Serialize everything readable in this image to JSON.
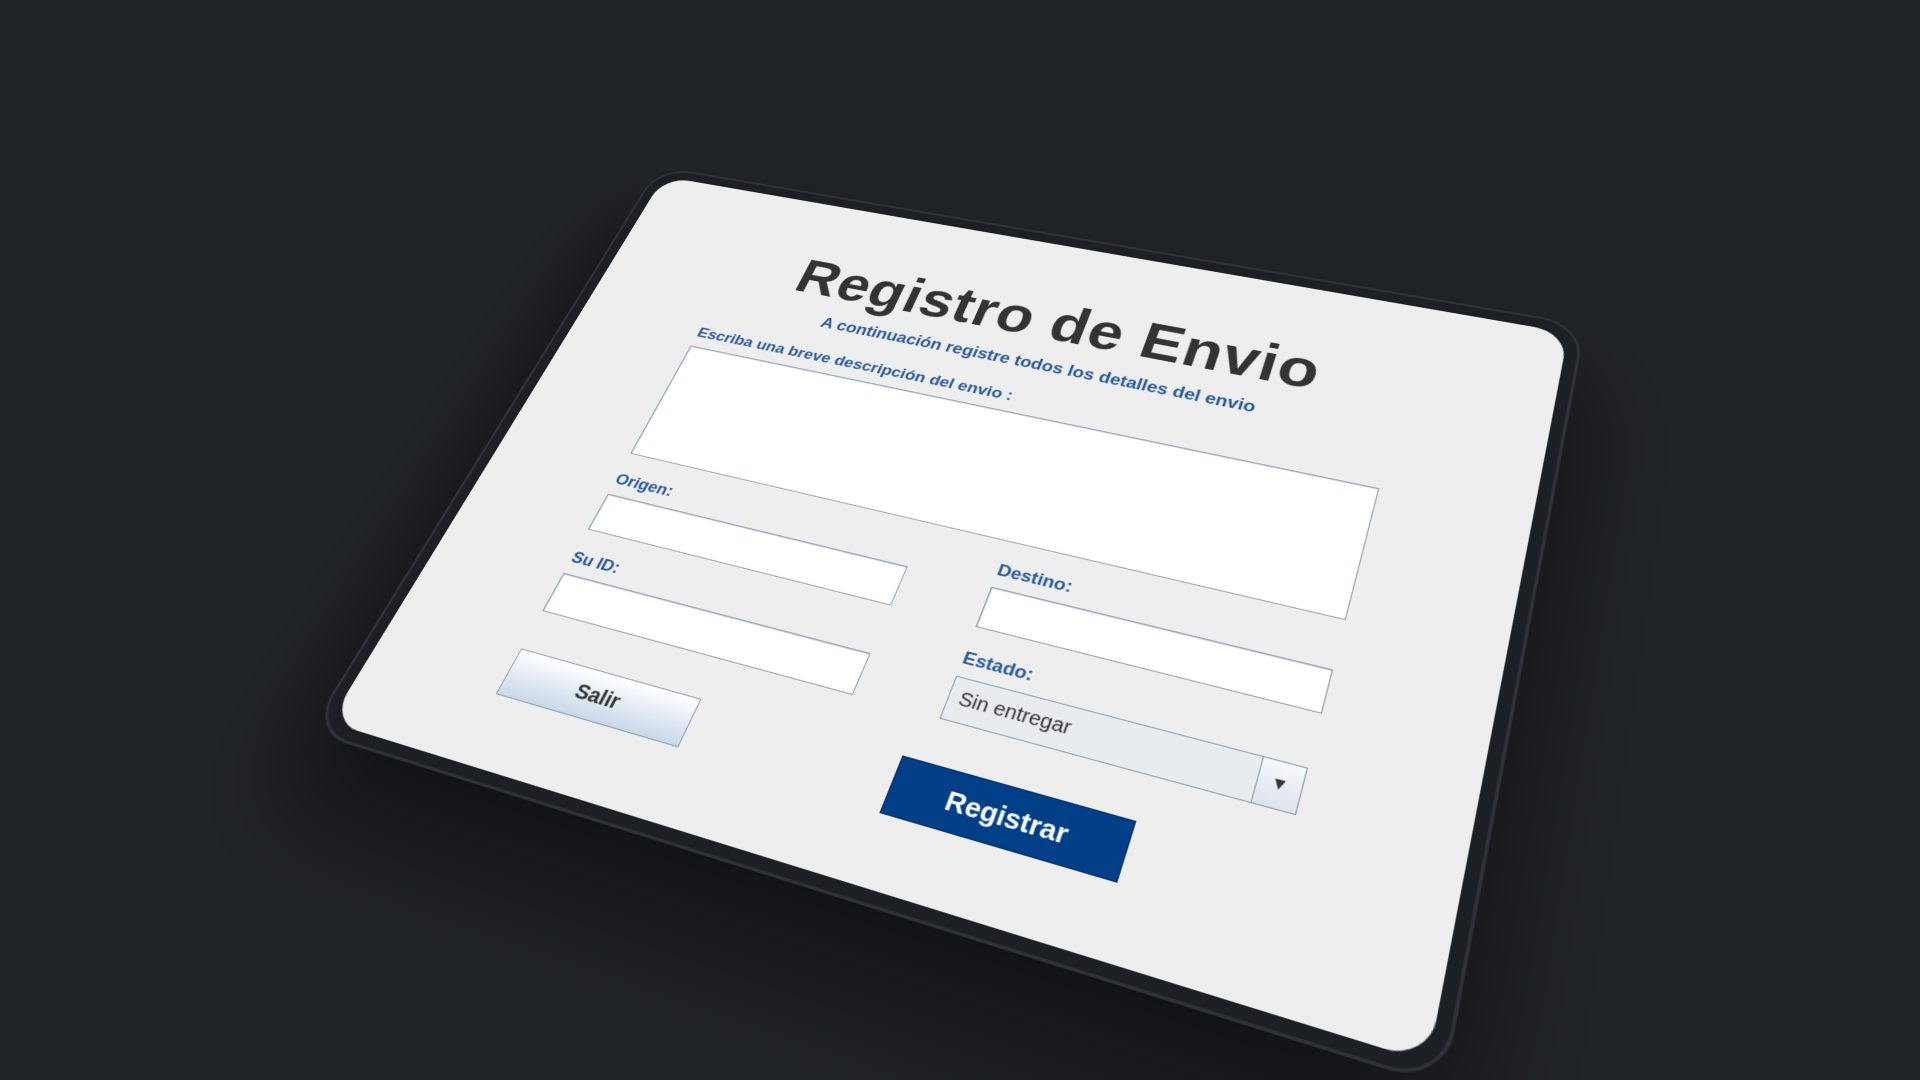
{
  "form": {
    "title": "Registro de Envio",
    "subtitle": "A continuación registre todos los detalles del envio",
    "description_label": "Escriba una breve descripción del envio :",
    "origin_label": "Origen:",
    "destination_label": "Destino:",
    "id_label": "Su ID:",
    "status_label": "Estado:",
    "status_value": "Sin entregar",
    "exit_button": "Salir",
    "register_button": "Registrar"
  },
  "colors": {
    "label_blue": "#2a5a9a",
    "primary_button": "#003f87",
    "background": "#202328",
    "panel": "#eeeeee"
  }
}
